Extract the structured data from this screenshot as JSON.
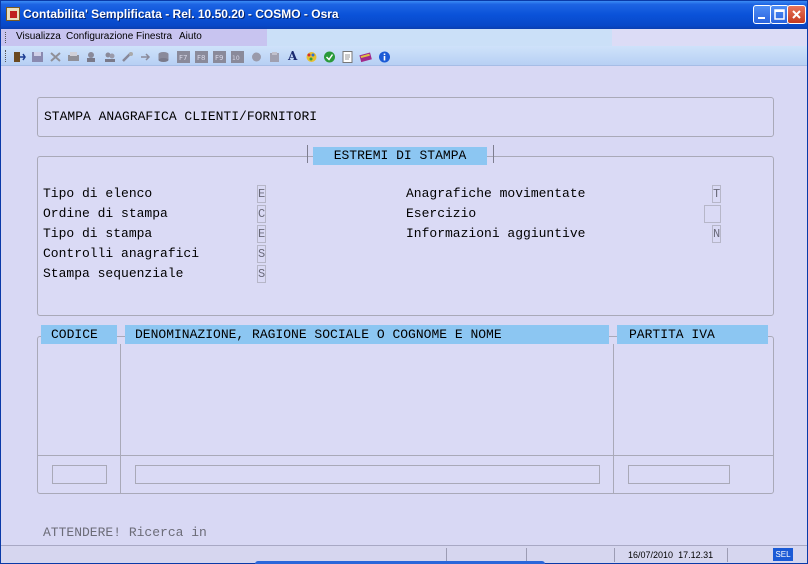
{
  "window": {
    "title": "Contabilita' Semplificata - Rel. 10.50.20 - COSMO - Osra",
    "minimize_icon": "minimize-icon",
    "maximize_icon": "maximize-icon",
    "close_icon": "close-icon"
  },
  "menu": {
    "items": [
      {
        "label": "Visualizza"
      },
      {
        "label": "Configurazione"
      },
      {
        "label": "Finestra"
      },
      {
        "label": "Aiuto"
      }
    ]
  },
  "toolbar": {
    "icons": [
      "exit-icon",
      "save-icon",
      "delete-icon",
      "print-icon",
      "user-icon",
      "users-icon",
      "tools-icon",
      "forward-icon",
      "database-icon",
      "f7-icon",
      "f8-icon",
      "f9-icon",
      "f10-icon",
      "record-icon",
      "archive-icon",
      "font-icon",
      "color-palette-icon",
      "ok-icon",
      "document-icon",
      "books-icon",
      "info-icon"
    ],
    "font_label": "A"
  },
  "form": {
    "title": "STAMPA ANAGRAFICA CLIENTI/FORNITORI",
    "section_title": "ESTREMI DI STAMPA",
    "left_fields": [
      {
        "label": "Tipo di elenco",
        "value": "E"
      },
      {
        "label": "Ordine di stampa",
        "value": "C"
      },
      {
        "label": "Tipo di stampa",
        "value": "E"
      },
      {
        "label": "Controlli anagrafici",
        "value": "S"
      },
      {
        "label": "Stampa sequenziale",
        "value": "S"
      }
    ],
    "right_fields": [
      {
        "label": "Anagrafiche movimentate",
        "value": "T"
      },
      {
        "label": "Esercizio",
        "value": ""
      },
      {
        "label": "Informazioni aggiuntive",
        "value": "N"
      }
    ]
  },
  "grid": {
    "columns": [
      "CODICE",
      "DENOMINAZIONE, RAGIONE SOCIALE O COGNOME E NOME",
      "PARTITA IVA"
    ]
  },
  "status": {
    "message": "ATTENDERE! Ricerca in",
    "date": "16/07/2010",
    "time": "17.12.31",
    "mode": "SEL"
  },
  "colors": {
    "title_bar": "#0a52d9",
    "background": "#d8d8f4",
    "header_accent": "#8cc6f2"
  }
}
